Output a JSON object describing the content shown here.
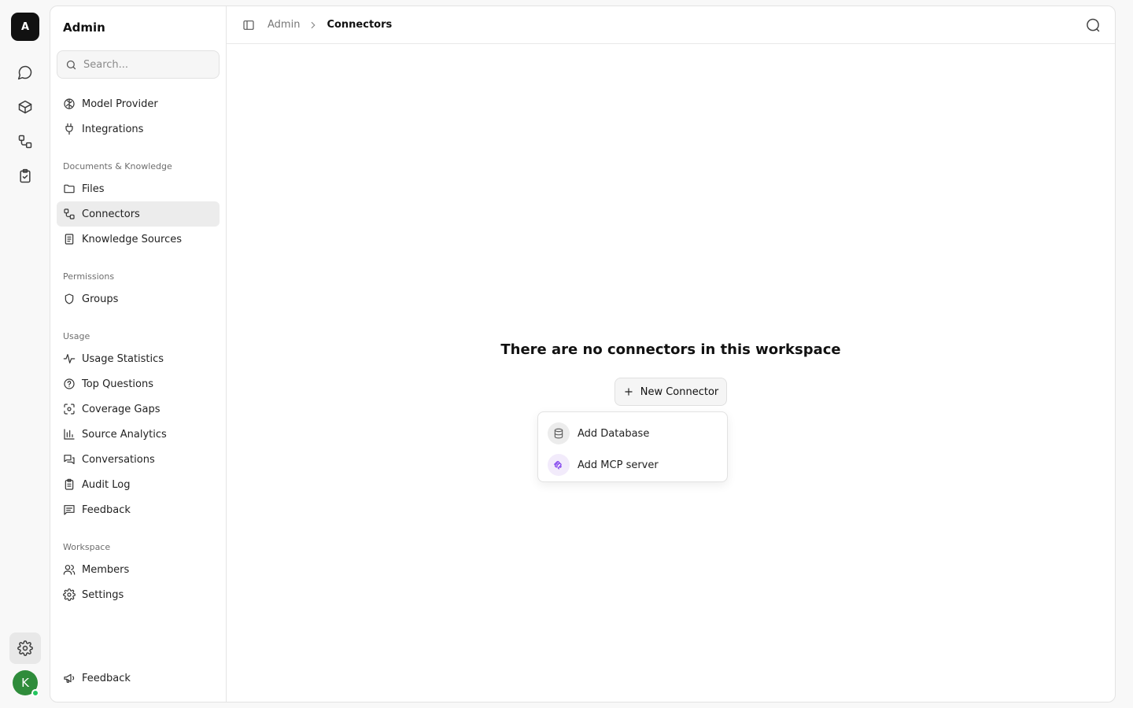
{
  "app": {
    "logo_letter": "A",
    "user_initial": "K"
  },
  "sidebar": {
    "title": "Admin",
    "search_placeholder": "Search...",
    "top_items": [
      {
        "label": "Model Provider",
        "icon": "brain-icon"
      },
      {
        "label": "Integrations",
        "icon": "plug-icon"
      }
    ],
    "sections": [
      {
        "label": "Documents & Knowledge",
        "items": [
          {
            "label": "Files",
            "icon": "folder-icon"
          },
          {
            "label": "Connectors",
            "icon": "connector-icon",
            "active": true
          },
          {
            "label": "Knowledge Sources",
            "icon": "book-icon"
          }
        ]
      },
      {
        "label": "Permissions",
        "items": [
          {
            "label": "Groups",
            "icon": "shield-icon"
          }
        ]
      },
      {
        "label": "Usage",
        "items": [
          {
            "label": "Usage Statistics",
            "icon": "activity-icon"
          },
          {
            "label": "Top Questions",
            "icon": "question-icon"
          },
          {
            "label": "Coverage Gaps",
            "icon": "scan-icon"
          },
          {
            "label": "Source Analytics",
            "icon": "bar-chart-icon"
          },
          {
            "label": "Conversations",
            "icon": "chat-bubbles-icon"
          },
          {
            "label": "Audit Log",
            "icon": "clipboard-icon"
          },
          {
            "label": "Feedback",
            "icon": "message-square-icon"
          }
        ]
      },
      {
        "label": "Workspace",
        "items": [
          {
            "label": "Members",
            "icon": "users-icon"
          },
          {
            "label": "Settings",
            "icon": "gear-icon"
          }
        ]
      }
    ],
    "footer_feedback": "Feedback"
  },
  "topbar": {
    "breadcrumb_parent": "Admin",
    "breadcrumb_current": "Connectors"
  },
  "empty_state": {
    "title": "There are no connectors in this workspace",
    "new_button": "New Connector"
  },
  "dropdown": {
    "items": [
      {
        "label": "Add Database",
        "icon": "database-icon"
      },
      {
        "label": "Add MCP server",
        "icon": "mcp-icon"
      }
    ]
  },
  "colors": {
    "accent_active_bg": "#ececec",
    "avatar_bg": "#2f8c3b",
    "status_online": "#22c55e",
    "mcp_icon": "#7c3aed"
  }
}
